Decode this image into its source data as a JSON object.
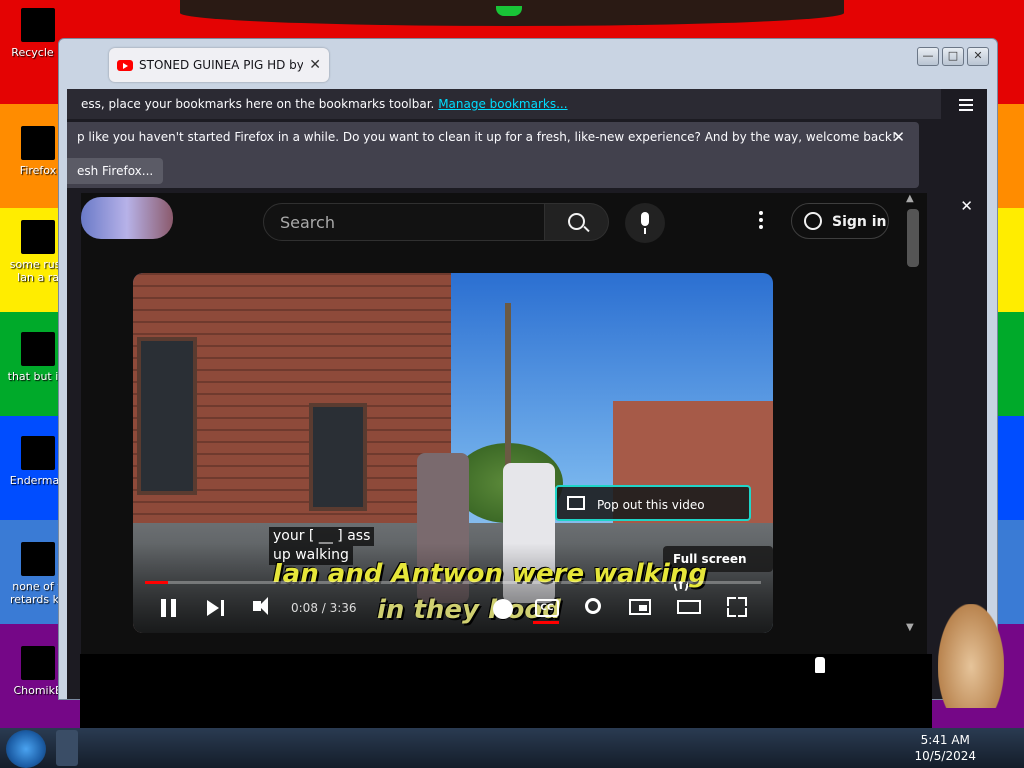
{
  "desktop": {
    "icons": [
      {
        "label": "Recycle B"
      },
      {
        "label": "Firefox"
      },
      {
        "label": "some russ Ian a ra"
      },
      {
        "label": "that but its"
      },
      {
        "label": "Enderman"
      },
      {
        "label": "none of y retards kn"
      },
      {
        "label": "ChomikB"
      }
    ]
  },
  "window": {
    "tab_title": "STONED GUINEA PIG HD by Gh",
    "tab_close": "✕",
    "controls": {
      "minimize": "—",
      "maximize": "□",
      "close": "✕"
    }
  },
  "browser": {
    "bookmarks_text": "ess, place your bookmarks here on the bookmarks toolbar.",
    "bookmarks_link": "Manage bookmarks...",
    "notification": "p like you haven't started Firefox in a while. Do you want to clean it up for a fresh, like-new experience? And by the way, welcome back!",
    "refresh_button": "esh Firefox...",
    "close": "✕"
  },
  "youtube": {
    "search_placeholder": "Search",
    "sign_in": "Sign in",
    "player": {
      "popout": "Pop out this video",
      "fullscreen_tip": "Full screen (f)",
      "caption_line1": "your [ __ ] ass",
      "caption_line2": "up walking",
      "lyric1": "Ian and Antwon were walking",
      "lyric2": "in they hood",
      "time": "0:08 / 3:36",
      "progress_fraction": 0.037,
      "cc_label": "CC"
    }
  },
  "taskbar": {
    "time": "5:41 AM",
    "date": "10/5/2024"
  },
  "colors": {
    "firefox_dark": "#1c1b22",
    "youtube_bg": "#0f0f0f",
    "accent_link": "#00ddff",
    "progress_red": "#ff0000",
    "popout_border": "#1fd5c8"
  }
}
